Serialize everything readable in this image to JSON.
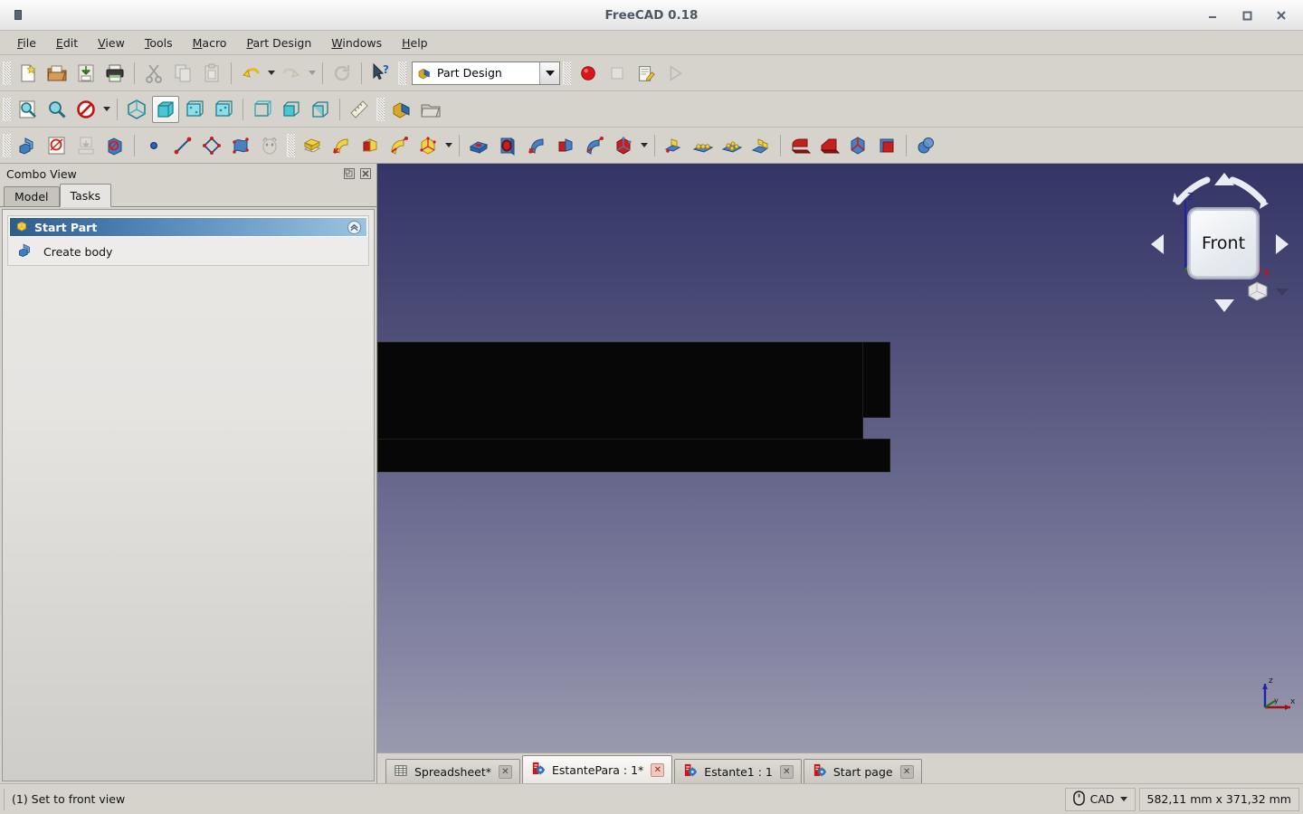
{
  "window": {
    "title": "FreeCAD 0.18",
    "app_badge": "app-icon",
    "controls": {
      "minimize": "minimize",
      "maximize": "maximize",
      "close": "close"
    }
  },
  "menubar": {
    "items": [
      {
        "label": "File",
        "mnemonic": "F"
      },
      {
        "label": "Edit",
        "mnemonic": "E"
      },
      {
        "label": "View",
        "mnemonic": "V"
      },
      {
        "label": "Tools",
        "mnemonic": "T"
      },
      {
        "label": "Macro",
        "mnemonic": "M"
      },
      {
        "label": "Part Design",
        "mnemonic": "P"
      },
      {
        "label": "Windows",
        "mnemonic": "W"
      },
      {
        "label": "Help",
        "mnemonic": "H"
      }
    ]
  },
  "toolbars": {
    "file": [
      {
        "name": "new-document-icon",
        "tip": "New"
      },
      {
        "name": "open-document-icon",
        "tip": "Open"
      },
      {
        "name": "save-document-icon",
        "tip": "Save"
      },
      {
        "name": "print-icon",
        "tip": "Print"
      }
    ],
    "edit": [
      {
        "name": "cut-icon",
        "tip": "Cut"
      },
      {
        "name": "copy-icon",
        "tip": "Copy"
      },
      {
        "name": "paste-icon",
        "tip": "Paste"
      }
    ],
    "history": [
      {
        "name": "undo-icon",
        "tip": "Undo"
      },
      {
        "name": "redo-icon",
        "tip": "Redo"
      }
    ],
    "refresh": {
      "name": "refresh-icon",
      "tip": "Refresh"
    },
    "whatsthis": {
      "name": "whats-this-icon",
      "tip": "What's this?"
    },
    "workbench": {
      "label": "Part Design",
      "icon": "part-design-icon"
    },
    "macro": [
      {
        "name": "macro-record-icon",
        "tip": "Macro recording"
      },
      {
        "name": "macro-stop-icon",
        "tip": "Stop macro recording"
      },
      {
        "name": "macro-edit-icon",
        "tip": "Macros"
      },
      {
        "name": "macro-execute-icon",
        "tip": "Execute macro"
      }
    ],
    "view_zoom": [
      {
        "name": "fit-all-icon",
        "tip": "Fits the whole content on the screen"
      },
      {
        "name": "fit-selection-icon",
        "tip": "Fit selection"
      },
      {
        "name": "draw-style-icon",
        "tip": "Draw style"
      }
    ],
    "std_views": [
      {
        "name": "isometric-view-icon",
        "tip": "Axonometric"
      },
      {
        "name": "front-view-icon",
        "tip": "Front",
        "active": true
      },
      {
        "name": "top-view-icon",
        "tip": "Top"
      },
      {
        "name": "right-view-icon",
        "tip": "Right"
      },
      {
        "name": "rear-view-icon",
        "tip": "Rear"
      },
      {
        "name": "bottom-view-icon",
        "tip": "Bottom"
      },
      {
        "name": "left-view-icon",
        "tip": "Left"
      }
    ],
    "measure": {
      "name": "measure-icon",
      "tip": "Measure"
    },
    "structure": [
      {
        "name": "create-part-icon",
        "tip": "Create part"
      },
      {
        "name": "create-group-icon",
        "tip": "Create group"
      }
    ],
    "partdesign_helper": [
      {
        "name": "create-body-icon",
        "tip": "Create body"
      },
      {
        "name": "create-sketch-icon",
        "tip": "Create sketch"
      },
      {
        "name": "attach-sketch-icon",
        "tip": "Attach sketch"
      },
      {
        "name": "validate-sketch-icon",
        "tip": "Validate sketch"
      }
    ],
    "sketch_geometry": [
      {
        "name": "create-point-icon",
        "tip": "Create point"
      },
      {
        "name": "create-line-icon",
        "tip": "Create line"
      },
      {
        "name": "create-polyline-icon",
        "tip": "Create polyline"
      },
      {
        "name": "create-bspline-icon",
        "tip": "Create B-spline"
      },
      {
        "name": "shape-binder-icon",
        "tip": "Shape binder"
      }
    ],
    "additive": [
      {
        "name": "pad-icon",
        "tip": "Pad"
      },
      {
        "name": "revolution-icon",
        "tip": "Revolution"
      },
      {
        "name": "additive-loft-icon",
        "tip": "Additive loft"
      },
      {
        "name": "additive-pipe-icon",
        "tip": "Additive pipe"
      },
      {
        "name": "additive-box-icon",
        "tip": "Additive box"
      }
    ],
    "subtractive": [
      {
        "name": "pocket-icon",
        "tip": "Pocket"
      },
      {
        "name": "hole-icon",
        "tip": "Hole"
      },
      {
        "name": "groove-icon",
        "tip": "Groove"
      },
      {
        "name": "subtractive-loft-icon",
        "tip": "Subtractive loft"
      },
      {
        "name": "subtractive-pipe-icon",
        "tip": "Subtractive pipe"
      },
      {
        "name": "subtractive-box-icon",
        "tip": "Subtractive box"
      }
    ],
    "transform": [
      {
        "name": "mirrored-icon",
        "tip": "Mirrored"
      },
      {
        "name": "linear-pattern-icon",
        "tip": "Linear pattern"
      },
      {
        "name": "polar-pattern-icon",
        "tip": "Polar pattern"
      },
      {
        "name": "multi-transform-icon",
        "tip": "Create multi transform"
      }
    ],
    "dressup": [
      {
        "name": "fillet-icon",
        "tip": "Fillet"
      },
      {
        "name": "chamfer-icon",
        "tip": "Chamfer"
      },
      {
        "name": "draft-icon",
        "tip": "Draft"
      },
      {
        "name": "thickness-icon",
        "tip": "Thickness"
      }
    ],
    "boolean": [
      {
        "name": "boolean-operation-icon",
        "tip": "Boolean operation"
      }
    ]
  },
  "combo_view": {
    "title": "Combo View",
    "float_icon": "undock-icon",
    "close_icon": "close-icon",
    "tabs": [
      {
        "label": "Model",
        "selected": false
      },
      {
        "label": "Tasks",
        "selected": true
      }
    ],
    "task_group": {
      "title": "Start Part",
      "icon": "part-icon",
      "collapse_icon": "chevron-up-icon",
      "items": [
        {
          "label": "Create body",
          "icon": "create-body-icon"
        }
      ]
    }
  },
  "view3d": {
    "navigation_cube": {
      "face_label": "Front",
      "axis_z_label": "z",
      "axis_x_label": "x",
      "arrows": [
        "up-arrow",
        "down-arrow",
        "left-arrow",
        "right-arrow",
        "rotate-left-arrow",
        "rotate-right-arrow"
      ],
      "mini_cube": "corner-cube-icon",
      "mini_dropdown": "chevron-down-icon"
    },
    "axis_cross": {
      "x": "X",
      "y": "Y",
      "z": "Z"
    },
    "background": {
      "top": "#343466",
      "bottom": "#9a9aae"
    },
    "object_color": "#070707"
  },
  "document_tabs": [
    {
      "label": "Spreadsheet*",
      "icon": "spreadsheet-icon",
      "selected": false,
      "close": "×"
    },
    {
      "label": "EstantePara : 1*",
      "icon": "freecad-doc-icon",
      "selected": true,
      "close": "×"
    },
    {
      "label": "Estante1 : 1",
      "icon": "freecad-doc-icon",
      "selected": false,
      "close": "×"
    },
    {
      "label": "Start page",
      "icon": "freecad-doc-icon",
      "selected": false,
      "close": "×"
    }
  ],
  "statusbar": {
    "message": "(1) Set to front view",
    "navigation_mode": {
      "label": "CAD",
      "icon": "mouse-icon"
    },
    "dimensions": "582,11 mm x 371,32 mm"
  }
}
